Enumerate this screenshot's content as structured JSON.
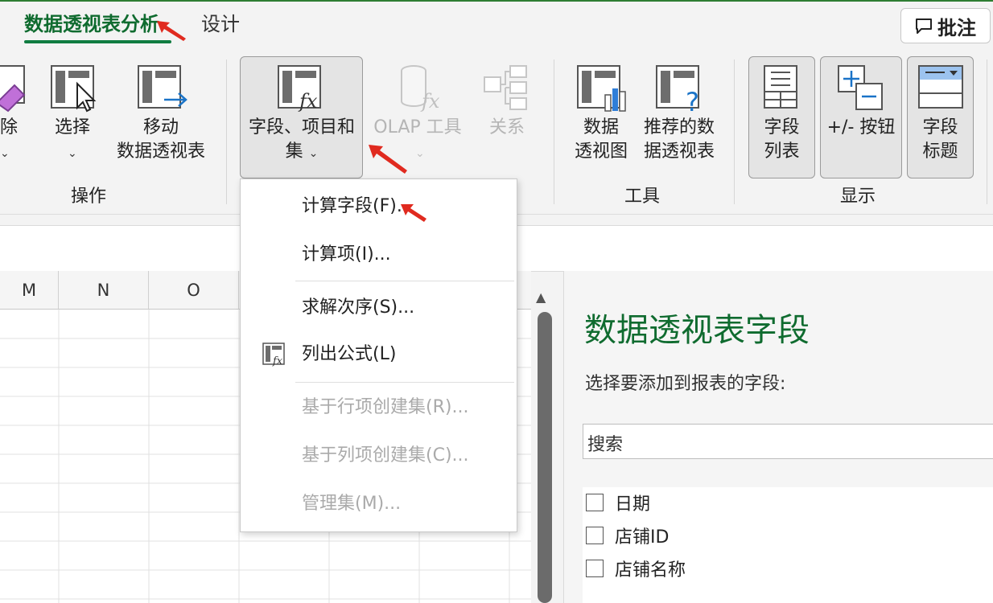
{
  "tabs": {
    "active": "数据透视表分析",
    "design": "设计",
    "comment_button": "批注"
  },
  "ribbon": {
    "actions_group": {
      "clear_partial": "除",
      "select": "选择",
      "move_line1": "移动",
      "move_line2": "数据透视表",
      "label": "操作"
    },
    "calc_group": {
      "fields_items_line1": "字段、项目和",
      "fields_items_line2": "集",
      "olap": "OLAP 工具",
      "relationships": "关系"
    },
    "tools_group": {
      "pivot_chart_line1": "数据",
      "pivot_chart_line2": "透视图",
      "recommended_line1": "推荐的数",
      "recommended_line2": "据透视表",
      "label": "工具"
    },
    "show_group": {
      "field_list_line1": "字段",
      "field_list_line2": "列表",
      "buttons": "+/- 按钮",
      "field_headers_line1": "字段",
      "field_headers_line2": "标题",
      "label": "显示"
    }
  },
  "grid": {
    "columns": [
      "M",
      "N",
      "O"
    ]
  },
  "menu": {
    "items": [
      {
        "label": "计算字段(F)...",
        "enabled": true
      },
      {
        "label": "计算项(I)...",
        "enabled": true
      },
      {
        "label": "求解次序(S)...",
        "enabled": true
      },
      {
        "label": "列出公式(L)",
        "enabled": true
      },
      {
        "label": "基于行项创建集(R)...",
        "enabled": false
      },
      {
        "label": "基于列项创建集(C)...",
        "enabled": false
      },
      {
        "label": "管理集(M)...",
        "enabled": false
      }
    ]
  },
  "field_pane": {
    "title": "数据透视表字段",
    "subtitle": "选择要添加到报表的字段:",
    "search_placeholder": "搜索",
    "fields": [
      "日期",
      "店铺ID",
      "店铺名称"
    ]
  },
  "colors": {
    "accent": "#107c41",
    "title_green": "#0f6b2f",
    "arrow_red": "#e02a1f",
    "disabled_text": "#aaaaaa"
  }
}
